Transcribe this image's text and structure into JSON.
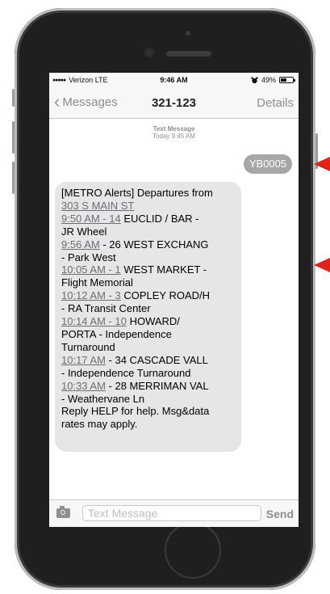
{
  "status_bar": {
    "signal_dots": "●●●●●",
    "carrier": "Verizon",
    "network": "LTE",
    "time": "9:46 AM",
    "battery_text": "49%",
    "battery_level": 0.49,
    "alarm_icon": "alarm-clock-icon"
  },
  "nav": {
    "back_label": "Messages",
    "title": "321-123",
    "details_label": "Details",
    "back_icon": "chevron-left-icon"
  },
  "conversation": {
    "timestamp_label": "Text Message",
    "timestamp_value": "Today 9:45 AM",
    "sent_message": "YB0005",
    "received": {
      "intro": "[METRO Alerts] Departures from",
      "stop": "303 S MAIN ST",
      "departures": [
        {
          "time": "9:50 AM - 14",
          "rest_first": " EUCLID / BAR -",
          "rest_second": "JR Wheel"
        },
        {
          "time": "9:56 AM",
          "rest_first": " - 26 WEST EXCHANG",
          "rest_second": "- Park West"
        },
        {
          "time": "10:05 AM - 1",
          "rest_first": " WEST MARKET -",
          "rest_second": "Flight Memorial"
        },
        {
          "time": "10:12 AM - 3",
          "rest_first": " COPLEY ROAD/H",
          "rest_second": "- RA Transit Center"
        },
        {
          "time": "10:14 AM - 10",
          "rest_first": " HOWARD/",
          "rest_second": "PORTA - Independence",
          "rest_third": "Turnaround"
        },
        {
          "time": "10:17 AM",
          "rest_first": " - 34 CASCADE VALL",
          "rest_second": "- Independence Turnaround"
        },
        {
          "time": "10:33 AM",
          "rest_first": " - 28 MERRIMAN VAL",
          "rest_second": "- Weathervane Ln"
        }
      ],
      "footer_line1": "Reply HELP for help. Msg&data",
      "footer_line2": "rates may apply."
    }
  },
  "input_bar": {
    "camera_icon": "camera-icon",
    "placeholder": "Text Message",
    "send_label": "Send"
  },
  "colors": {
    "annotation_arrow": "#e2231a",
    "sent_bubble": "#a7a7a9",
    "received_bubble": "#e6e6e8",
    "link_text": "#6e6e73"
  }
}
